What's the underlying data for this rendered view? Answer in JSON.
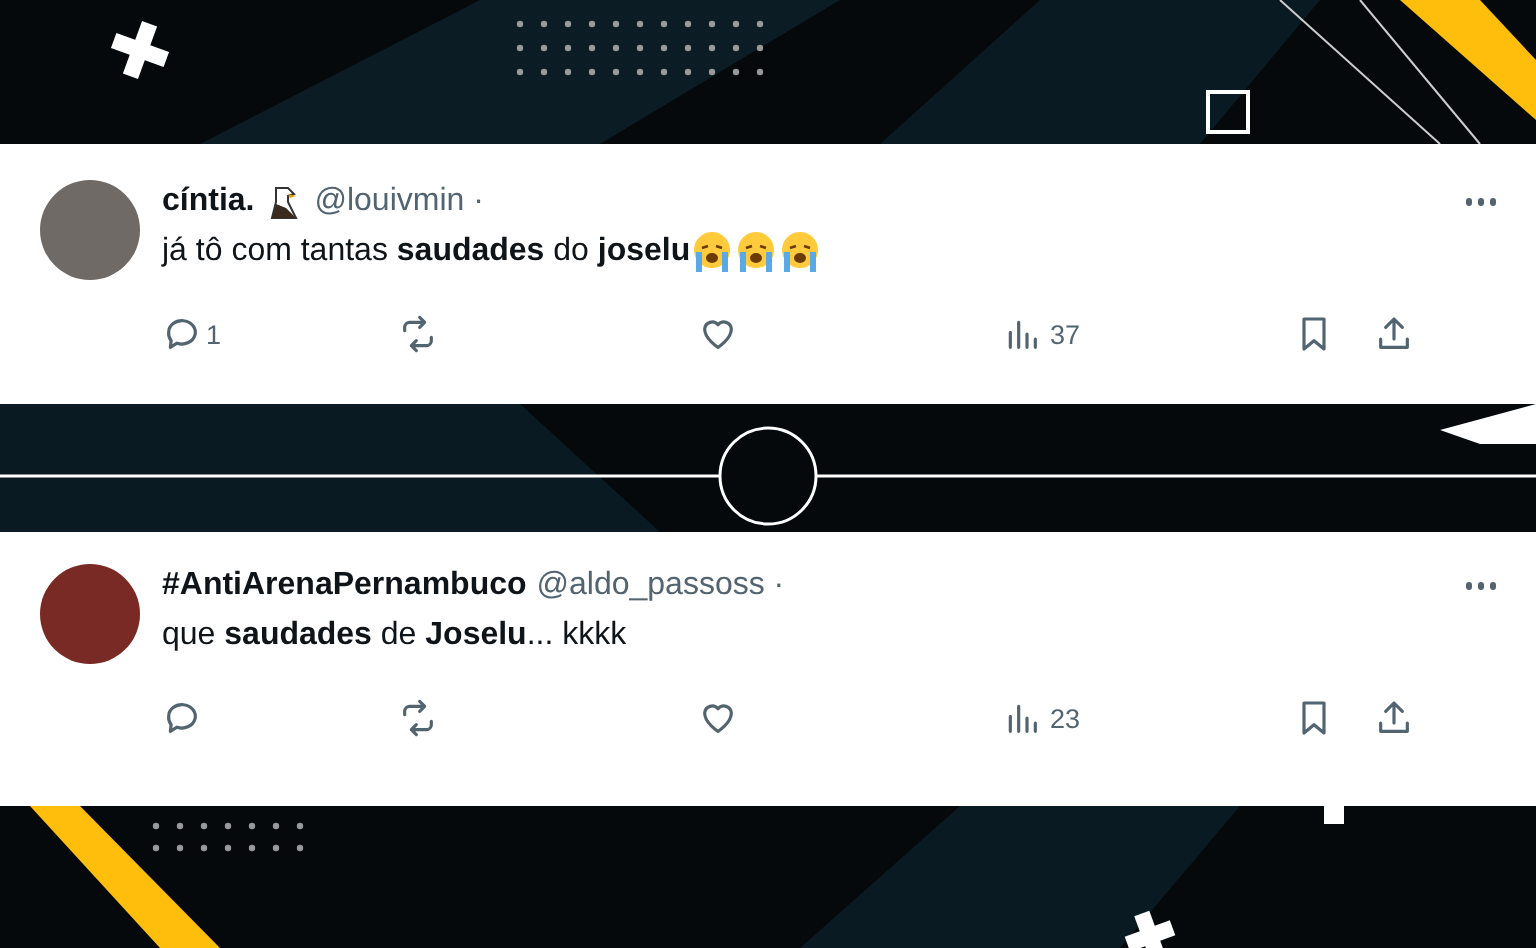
{
  "tweets": [
    {
      "name": "cíntia.",
      "name_badge": true,
      "handle": "@louivmin ·",
      "text": "já tô com tantas **saudades** do **joselu**",
      "emojis": [
        {
          "kind": "crying"
        },
        {
          "kind": "crying"
        },
        {
          "kind": "crying"
        }
      ],
      "replies": "1",
      "views": "37"
    },
    {
      "name": "#AntiArenaPernambuco",
      "name_badge": false,
      "handle": "@aldo_passoss ·",
      "text": "que **saudades** de **Joselu**... kkkk",
      "views": "23"
    }
  ]
}
